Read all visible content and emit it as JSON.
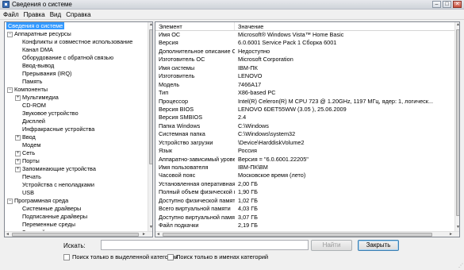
{
  "window": {
    "title": "Сведения о системе",
    "btn_min": "–",
    "btn_max": "□",
    "btn_close": "✕"
  },
  "menu": [
    "Файл",
    "Правка",
    "Вид",
    "Справка"
  ],
  "tree": [
    {
      "label": "Сведения о системе",
      "indent": 0,
      "exp": "",
      "selected": true
    },
    {
      "label": "Аппаратные ресурсы",
      "indent": 1,
      "exp": "−"
    },
    {
      "label": "Конфликты и совместное использование",
      "indent": 2,
      "exp": ""
    },
    {
      "label": "Канал DMA",
      "indent": 2,
      "exp": ""
    },
    {
      "label": "Оборудование с обратной связью",
      "indent": 2,
      "exp": ""
    },
    {
      "label": "Ввод-вывод",
      "indent": 2,
      "exp": ""
    },
    {
      "label": "Прерывания (IRQ)",
      "indent": 2,
      "exp": ""
    },
    {
      "label": "Память",
      "indent": 2,
      "exp": ""
    },
    {
      "label": "Компоненты",
      "indent": 1,
      "exp": "−"
    },
    {
      "label": "Мультимедиа",
      "indent": 2,
      "exp": "+"
    },
    {
      "label": "CD-ROM",
      "indent": 2,
      "exp": ""
    },
    {
      "label": "Звуковое устройство",
      "indent": 2,
      "exp": ""
    },
    {
      "label": "Дисплей",
      "indent": 2,
      "exp": ""
    },
    {
      "label": "Инфракрасные устройства",
      "indent": 2,
      "exp": ""
    },
    {
      "label": "Ввод",
      "indent": 2,
      "exp": "+"
    },
    {
      "label": "Модем",
      "indent": 2,
      "exp": ""
    },
    {
      "label": "Сеть",
      "indent": 2,
      "exp": "+"
    },
    {
      "label": "Порты",
      "indent": 2,
      "exp": "+"
    },
    {
      "label": "Запоминающие устройства",
      "indent": 2,
      "exp": "+"
    },
    {
      "label": "Печать",
      "indent": 2,
      "exp": ""
    },
    {
      "label": "Устройства с неполадками",
      "indent": 2,
      "exp": ""
    },
    {
      "label": "USB",
      "indent": 2,
      "exp": ""
    },
    {
      "label": "Программная среда",
      "indent": 1,
      "exp": "−"
    },
    {
      "label": "Системные драйверы",
      "indent": 2,
      "exp": ""
    },
    {
      "label": "Подписанные драйверы",
      "indent": 2,
      "exp": ""
    },
    {
      "label": "Переменные среды",
      "indent": 2,
      "exp": ""
    },
    {
      "label": "Заданий для принтера",
      "indent": 2,
      "exp": ""
    }
  ],
  "table": {
    "headers": [
      "Элемент",
      "Значение"
    ],
    "rows": [
      [
        "Имя ОС",
        "Microsoft® Windows Vista™ Home Basic"
      ],
      [
        "Версия",
        "6.0.6001 Service Pack 1 Сборка 6001"
      ],
      [
        "Дополнительное описание ОС",
        "Недоступно"
      ],
      [
        "Изготовитель ОС",
        "Microsoft Corporation"
      ],
      [
        "Имя системы",
        "IBM-ПК"
      ],
      [
        "Изготовитель",
        "LENOVO"
      ],
      [
        "Модель",
        "7466A17"
      ],
      [
        "Тип",
        "X86-based PC"
      ],
      [
        "Процессор",
        "Intel(R) Celeron(R) M CPU        723  @ 1.20GHz, 1197 МГц, ядер: 1, логическ..."
      ],
      [
        "Версия BIOS",
        "LENOVO 6DET55WW (3.05 ), 25.06.2009"
      ],
      [
        "Версия SMBIOS",
        "2.4"
      ],
      [
        "Папка Windows",
        "C:\\Windows"
      ],
      [
        "Системная папка",
        "C:\\Windows\\system32"
      ],
      [
        "Устройство загрузки",
        "\\Device\\HarddiskVolume2"
      ],
      [
        "Язык",
        "Россия"
      ],
      [
        "Аппаратно-зависимый уровен...",
        "Версия = \"6.0.6001.22205\""
      ],
      [
        "Имя пользователя",
        "IBM-ПК\\BM"
      ],
      [
        "Часовой пояс",
        "Московское время (лето)"
      ],
      [
        "Установленная оперативная п...",
        "2,00 ГБ"
      ],
      [
        "Полный объем физической па...",
        "1,90 ГБ"
      ],
      [
        "Доступно физической памяти",
        "1,02 ГБ"
      ],
      [
        "Всего виртуальной памяти",
        "4,03 ГБ"
      ],
      [
        "Доступно виртуальной памяти",
        "3,07 ГБ"
      ],
      [
        "Файл подкачки",
        "2,19 ГБ"
      ],
      [
        "Файл подкачки",
        "C:\\pagefile.sys"
      ]
    ]
  },
  "search": {
    "label": "Искать:",
    "value": "",
    "find_button": "Найти",
    "close_button": "Закрыть",
    "check_selected": "Поиск только в выделенной категории",
    "check_names": "Поиск только в именах категорий"
  },
  "scroll": {
    "up": "▲",
    "down": "▼",
    "left": "◄",
    "right": "►",
    "grip": "⋰"
  }
}
